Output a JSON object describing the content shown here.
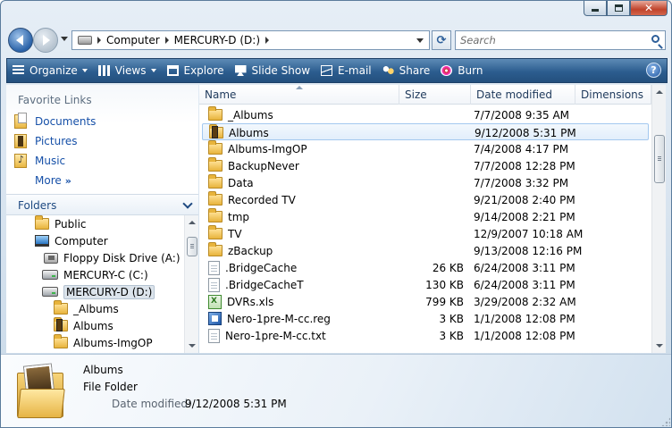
{
  "address": {
    "crumbs": [
      "Computer",
      "MERCURY-D (D:)"
    ]
  },
  "search": {
    "placeholder": "Search"
  },
  "toolbar": {
    "organize": "Organize",
    "views": "Views",
    "explore": "Explore",
    "slideshow": "Slide Show",
    "email": "E-mail",
    "share": "Share",
    "burn": "Burn"
  },
  "favorites": {
    "heading": "Favorite Links",
    "items": [
      {
        "label": "Documents",
        "icon": "documents-icon"
      },
      {
        "label": "Pictures",
        "icon": "pictures-icon"
      },
      {
        "label": "Music",
        "icon": "music-icon"
      },
      {
        "label": "More",
        "icon": "more-icon"
      }
    ]
  },
  "folders": {
    "heading": "Folders",
    "tree": [
      {
        "label": "Public",
        "icon": "folder-icon"
      },
      {
        "label": "Computer",
        "icon": "computer-icon"
      },
      {
        "label": "Floppy Disk Drive (A:)",
        "icon": "floppy-icon"
      },
      {
        "label": "MERCURY-C (C:)",
        "icon": "hard-drive-icon"
      },
      {
        "label": "MERCURY-D (D:)",
        "icon": "hard-drive-icon",
        "selected": true
      },
      {
        "label": "_Albums",
        "icon": "folder-icon"
      },
      {
        "label": "Albums",
        "icon": "picture-folder-icon"
      },
      {
        "label": "Albums-ImgOP",
        "icon": "folder-icon"
      }
    ]
  },
  "columns": {
    "name": "Name",
    "size": "Size",
    "date": "Date modified",
    "dimensions": "Dimensions"
  },
  "files": [
    {
      "name": "_Albums",
      "size": "",
      "date": "7/7/2008 9:35 AM",
      "icon": "folder-icon"
    },
    {
      "name": "Albums",
      "size": "",
      "date": "9/12/2008 5:31 PM",
      "icon": "picture-folder-icon",
      "selected": true
    },
    {
      "name": "Albums-ImgOP",
      "size": "",
      "date": "7/4/2008 4:17 PM",
      "icon": "folder-icon"
    },
    {
      "name": "BackupNever",
      "size": "",
      "date": "7/7/2008 12:28 PM",
      "icon": "folder-icon"
    },
    {
      "name": "Data",
      "size": "",
      "date": "7/7/2008 3:32 PM",
      "icon": "folder-icon"
    },
    {
      "name": "Recorded TV",
      "size": "",
      "date": "9/21/2008 2:40 PM",
      "icon": "folder-icon"
    },
    {
      "name": "tmp",
      "size": "",
      "date": "9/14/2008 2:21 PM",
      "icon": "folder-icon"
    },
    {
      "name": "TV",
      "size": "",
      "date": "12/9/2007 10:18 AM",
      "icon": "folder-icon"
    },
    {
      "name": "zBackup",
      "size": "",
      "date": "9/13/2008 12:16 PM",
      "icon": "folder-icon"
    },
    {
      "name": ".BridgeCache",
      "size": "26 KB",
      "date": "6/24/2008 3:11 PM",
      "icon": "file-icon"
    },
    {
      "name": ".BridgeCacheT",
      "size": "130 KB",
      "date": "6/24/2008 3:11 PM",
      "icon": "file-icon"
    },
    {
      "name": "DVRs.xls",
      "size": "799 KB",
      "date": "3/29/2008 2:32 AM",
      "icon": "excel-icon"
    },
    {
      "name": "Nero-1pre-M-cc.reg",
      "size": "3 KB",
      "date": "1/1/2008 12:08 PM",
      "icon": "registry-icon"
    },
    {
      "name": "Nero-1pre-M-cc.txt",
      "size": "3 KB",
      "date": "1/1/2008 12:08 PM",
      "icon": "text-file-icon"
    }
  ],
  "details": {
    "name": "Albums",
    "type": "File Folder",
    "date_label": "Date modified:",
    "date_value": "9/12/2008 5:31 PM"
  },
  "colors": {
    "toolbar": "#2c5d8f",
    "link": "#1650a8",
    "selection": "#e2eefb"
  }
}
